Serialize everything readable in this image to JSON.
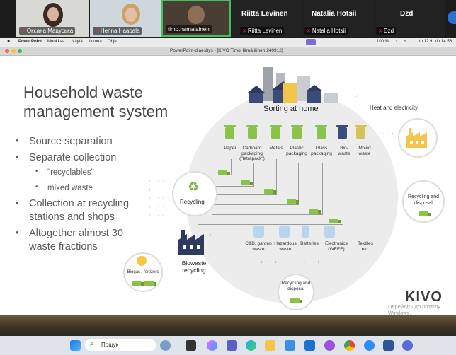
{
  "participants": [
    {
      "name": "Оксана Мацуська"
    },
    {
      "name": "Henna Haapala"
    },
    {
      "name": "timo.hamalainen"
    },
    {
      "name": "Riitta Levinen"
    },
    {
      "name": "Natalia Hotsii"
    },
    {
      "name": "Dzd"
    }
  ],
  "big_names": [
    "Riitta Levinen",
    "Natalia Hotsii",
    "Dzd"
  ],
  "menubar": {
    "app": "PowerPoint",
    "items": [
      "Muokkaa",
      "Näytä",
      "Ikkuna",
      "Ohje"
    ],
    "battery": "100 %",
    "datetime": "to 12.9. klo 14.56"
  },
  "ppt_title": "PowerPoint-diaesitys - [KIVO TimoHämäläinen 240912]",
  "slide": {
    "title_line1": "Household waste",
    "title_line2": "management system",
    "bullets": [
      {
        "text": "Source separation",
        "level": 1
      },
      {
        "text": "Separate collection",
        "level": 1
      },
      {
        "text": "\"recyclables\"",
        "level": 2
      },
      {
        "text": "mixed waste",
        "level": 2
      },
      {
        "text": "Collection at recycling",
        "level": 1
      },
      {
        "text": "stations and shops",
        "level": 1,
        "continuation": true
      },
      {
        "text": "Altogether almost 30",
        "level": 1
      },
      {
        "text": "waste fractions",
        "level": 1,
        "continuation": true
      }
    ],
    "sorting_label": "Sorting at home",
    "heat_label": "Heat and electricity",
    "bins": [
      {
        "label": "Paper",
        "color": "green"
      },
      {
        "label": "Carboard packaging (\"tetrapack\")",
        "color": "green"
      },
      {
        "label": "Metals",
        "color": "green"
      },
      {
        "label": "Plastic packaging",
        "color": "green"
      },
      {
        "label": "Glass packaging",
        "color": "green"
      },
      {
        "label": "Bio-waste",
        "color": "blue"
      },
      {
        "label": "Mixed waste",
        "color": "yellow"
      }
    ],
    "recycling_label": "Recycling",
    "recycling_disposal_right": "Recycling and disposal",
    "recycling_disposal_bottom": "Recycling and disposal",
    "biowaste_label": "Biowaste recycling",
    "biogas_label": "Biogas / fertizers",
    "special": [
      {
        "label": "C&D, garden waste"
      },
      {
        "label": "Hazardous waste"
      },
      {
        "label": "Batteries"
      },
      {
        "label": "Electronics (WEEE)"
      },
      {
        "label": "Textiles etc."
      }
    ],
    "logo": "KIVO",
    "watermark_line1": "Перейдіть до розділу",
    "watermark_line2": "Windows."
  },
  "taskbar": {
    "search_placeholder": "Пошук"
  },
  "colors": {
    "green": "#8bc34a",
    "dark_blue": "#3b4b7a",
    "factory_yellow": "#f3c54a",
    "title_text": "#444444"
  }
}
